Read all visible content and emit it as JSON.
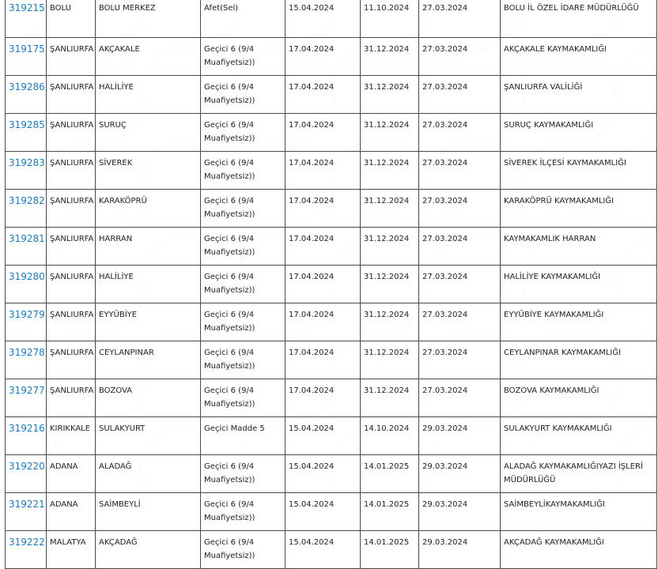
{
  "rows": [
    {
      "id": "319215",
      "city": "BOLU",
      "district": "BOLU MERKEZ",
      "type": "Afet(Sel)",
      "start": "15.04.2024",
      "end": "11.10.2024",
      "date": "27.03.2024",
      "office": "BOLU İL ÖZEL İDARE MÜDÜRLÜĞÜ"
    },
    {
      "id": "319175",
      "city": "ŞANLIURFA",
      "district": "AKÇAKALE",
      "type": "Geçici 6 (9/4 Muafiyetsiz))",
      "start": "17.04.2024",
      "end": "31.12.2024",
      "date": "27.03.2024",
      "office": "AKÇAKALE KAYMAKAMLIĞI"
    },
    {
      "id": "319286",
      "city": "ŞANLIURFA",
      "district": "HALİLİYE",
      "type": "Geçici 6 (9/4 Muafiyetsiz))",
      "start": "17.04.2024",
      "end": "31.12.2024",
      "date": "27.03.2024",
      "office": "ŞANLIURFA VALİLİĞİ"
    },
    {
      "id": "319285",
      "city": "ŞANLIURFA",
      "district": "SURUÇ",
      "type": "Geçici 6 (9/4 Muafiyetsiz))",
      "start": "17.04.2024",
      "end": "31.12.2024",
      "date": "27.03.2024",
      "office": "SURUÇ KAYMAKAMLIĞI"
    },
    {
      "id": "319283",
      "city": "ŞANLIURFA",
      "district": "SİVEREK",
      "type": "Geçici 6 (9/4 Muafiyetsiz))",
      "start": "17.04.2024",
      "end": "31.12.2024",
      "date": "27.03.2024",
      "office": "SİVEREK İLÇESİ KAYMAKAMLIĞI"
    },
    {
      "id": "319282",
      "city": "ŞANLIURFA",
      "district": "KARAKÖPRÜ",
      "type": "Geçici 6 (9/4 Muafiyetsiz))",
      "start": "17.04.2024",
      "end": "31.12.2024",
      "date": "27.03.2024",
      "office": "KARAKÖPRÜ KAYMAKAMLIĞI"
    },
    {
      "id": "319281",
      "city": "ŞANLIURFA",
      "district": "HARRAN",
      "type": "Geçici 6 (9/4 Muafiyetsiz))",
      "start": "17.04.2024",
      "end": "31.12.2024",
      "date": "27.03.2024",
      "office": "KAYMAKAMLIK HARRAN"
    },
    {
      "id": "319280",
      "city": "ŞANLIURFA",
      "district": "HALİLİYE",
      "type": "Geçici 6 (9/4 Muafiyetsiz))",
      "start": "17.04.2024",
      "end": "31.12.2024",
      "date": "27.03.2024",
      "office": "HALİLİYE KAYMAKAMLIĞI"
    },
    {
      "id": "319279",
      "city": "ŞANLIURFA",
      "district": "EYYÜBİYE",
      "type": "Geçici 6 (9/4 Muafiyetsiz))",
      "start": "17.04.2024",
      "end": "31.12.2024",
      "date": "27.03.2024",
      "office": "EYYÜBİYE KAYMAKAMLIĞI"
    },
    {
      "id": "319278",
      "city": "ŞANLIURFA",
      "district": "CEYLANPINAR",
      "type": "Geçici 6 (9/4 Muafiyetsiz))",
      "start": "17.04.2024",
      "end": "31.12.2024",
      "date": "27.03.2024",
      "office": "CEYLANPINAR KAYMAKAMLIĞI"
    },
    {
      "id": "319277",
      "city": "ŞANLIURFA",
      "district": "BOZOVA",
      "type": "Geçici 6 (9/4 Muafiyetsiz))",
      "start": "17.04.2024",
      "end": "31.12.2024",
      "date": "27.03.2024",
      "office": "BOZOVA KAYMAKAMLIĞI"
    },
    {
      "id": "319216",
      "city": "KIRIKKALE",
      "district": "SULAKYURT",
      "type": "Geçici Madde 5",
      "start": "15.04.2024",
      "end": "14.10.2024",
      "date": "29.03.2024",
      "office": "SULAKYURT KAYMAKAMLIĞI"
    },
    {
      "id": "319220",
      "city": "ADANA",
      "district": "ALADAĞ",
      "type": "Geçici 6 (9/4 Muafiyetsiz))",
      "start": "15.04.2024",
      "end": "14.01.2025",
      "date": "29.03.2024",
      "office": "ALADAĞ KAYMAKAMLIĞIYAZI İŞLERİ MÜDÜRLÜĞÜ"
    },
    {
      "id": "319221",
      "city": "ADANA",
      "district": "SAİMBEYLİ",
      "type": "Geçici 6 (9/4 Muafiyetsiz))",
      "start": "15.04.2024",
      "end": "14.01.2025",
      "date": "29.03.2024",
      "office": "SAİMBEYLİKAYMAKAMLIĞI"
    },
    {
      "id": "319222",
      "city": "MALATYA",
      "district": "AKÇADAĞ",
      "type": "Geçici 6 (9/4 Muafiyetsiz))",
      "start": "15.04.2024",
      "end": "14.01.2025",
      "date": "29.03.2024",
      "office": "AKÇADAĞ KAYMAKAMLIĞI"
    }
  ]
}
